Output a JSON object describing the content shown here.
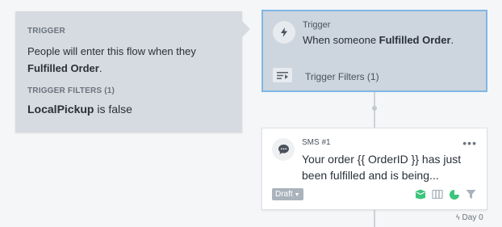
{
  "tooltip": {
    "trigger_label": "TRIGGER",
    "trigger_text_pre": "People will enter this flow when they ",
    "trigger_text_bold": "Fulfilled Order",
    "trigger_text_post": ".",
    "filters_label": "TRIGGER FILTERS (1)",
    "filter_bold": "LocalPickup",
    "filter_rest": " is false"
  },
  "trigger_node": {
    "title": "Trigger",
    "desc_pre": "When someone ",
    "desc_bold": "Fulfilled Order",
    "desc_post": ".",
    "filters_label": "Trigger Filters (1)",
    "icons": {
      "main": "lightning-icon",
      "filters": "filter-list-icon"
    }
  },
  "sms_node": {
    "title": "SMS #1",
    "more": "•••",
    "body": "Your order {{ OrderID }} has just been fulfilled and is being...",
    "status": "Draft",
    "icons": [
      "sms-content-icon",
      "smart-sending-icon",
      "pie-chart-icon",
      "filter-icon"
    ]
  },
  "timeline": {
    "day_label": "Day 0"
  },
  "colors": {
    "accent_border": "#7fb7e6",
    "status_green": "#3cc47c",
    "draft_bg": "#aab3bc"
  }
}
